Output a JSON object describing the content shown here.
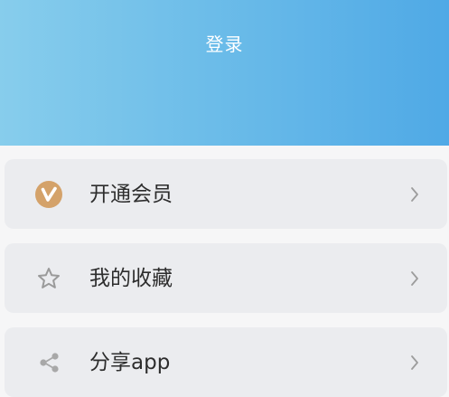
{
  "header": {
    "login_label": "登录",
    "gradient_start": "#87cdec",
    "gradient_end": "#4fa9e6"
  },
  "menu": {
    "items": [
      {
        "label": "开通会员",
        "icon": "vip-badge-icon",
        "icon_color": "#d4a26a"
      },
      {
        "label": "我的收藏",
        "icon": "star-icon",
        "icon_color": "#9a9a9a"
      },
      {
        "label": "分享app",
        "icon": "share-icon",
        "icon_color": "#a8a8a8"
      }
    ],
    "chevron_icon": "chevron-right-icon"
  },
  "colors": {
    "page_background": "#f6f6f7",
    "item_background": "#ebecef",
    "label_text": "#2d2d2d"
  }
}
